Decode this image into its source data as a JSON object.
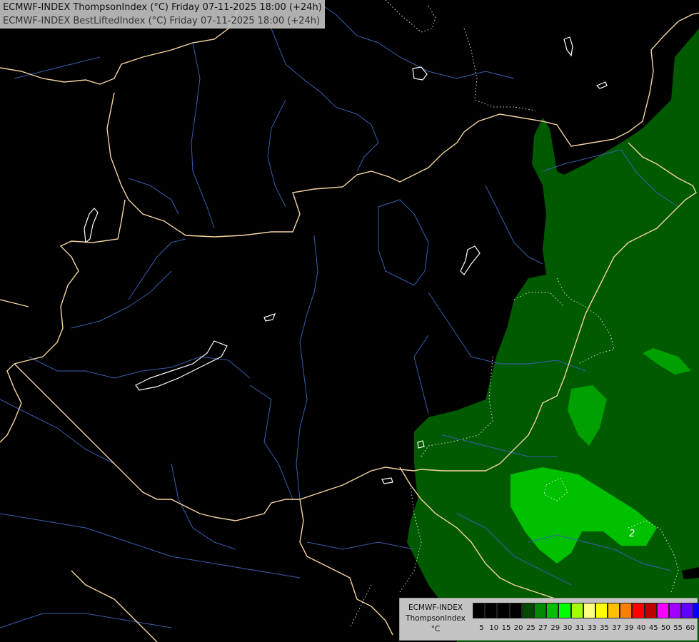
{
  "header": {
    "line1": "ECMWF-INDEX ThompsonIndex (°C) Friday 07-11-2025 18:00 (+24h)",
    "line2": "ECMWF-INDEX BestLiftedIndex (°C) Friday 07-11-2025 18:00 (+24h)"
  },
  "legend": {
    "title_line1": "ECMWF-INDEX",
    "title_line2": "ThompsonIndex",
    "unit": "°C",
    "levels": [
      "5",
      "10",
      "15",
      "20",
      "25",
      "27",
      "29",
      "30",
      "31",
      "33",
      "35",
      "37",
      "39",
      "40",
      "45",
      "50",
      "55",
      "60"
    ],
    "colors": [
      "#000000",
      "#000000",
      "#000000",
      "#000000",
      "#004800",
      "#008800",
      "#00c000",
      "#00ff00",
      "#a0ff00",
      "#ffff80",
      "#ffff00",
      "#ffc000",
      "#ff8000",
      "#ff0000",
      "#c00000",
      "#ff00ff",
      "#a000ff",
      "#6000ff",
      "#0000ff"
    ]
  },
  "contour_labels": [
    "2"
  ],
  "colors": {
    "border": "#f5d5a0",
    "river": "#3a5fb0",
    "field_dark": "#005a00",
    "field_mid": "#00a000",
    "field_light": "#00c000"
  }
}
